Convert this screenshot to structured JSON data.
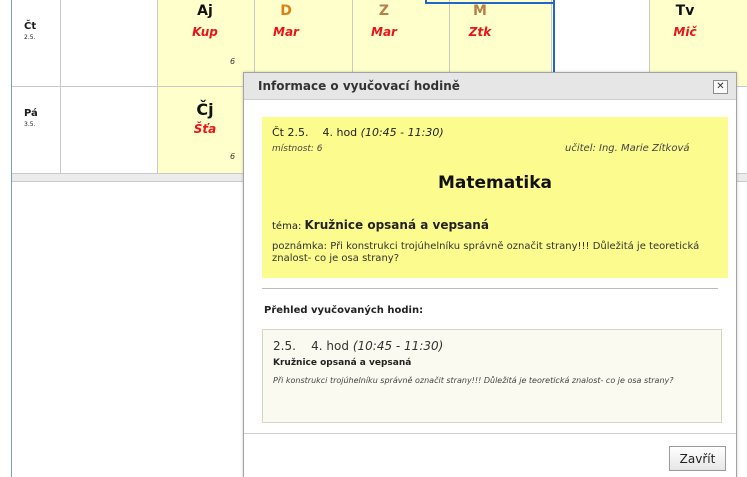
{
  "timetable": {
    "days": [
      {
        "label": "Čt",
        "date": "2.5."
      },
      {
        "label": "Pá",
        "date": "3.5."
      }
    ],
    "thursday": {
      "aj": {
        "subject": "Aj",
        "teacher": "Kup",
        "room": "6"
      },
      "d": {
        "subject": "D",
        "teacher": "Mar"
      },
      "z": {
        "subject": "Z",
        "teacher": "Mar"
      },
      "m": {
        "subject": "M",
        "teacher": "Ztk"
      },
      "tv": {
        "subject": "Tv",
        "teacher": "Mič"
      }
    },
    "friday": {
      "cj": {
        "subject": "Čj",
        "teacher": "Šťa",
        "room": "6"
      }
    }
  },
  "dialog": {
    "title": "Informace o vyučovací hodině",
    "close_glyph": "✕",
    "lesson": {
      "date": "Čt 2.5.",
      "hour": "4. hod",
      "time": "(10:45 - 11:30)",
      "room": "místnost: 6",
      "teacher": "učitel: Ing. Marie Zítková",
      "subject": "Matematika",
      "topic_label": "téma:",
      "topic": "Kružnice opsaná a vepsaná",
      "note": "poznámka: Při konstrukci trojúhelníku správně označit strany!!! Důležitá je teoretická znalost- co je osa strany?"
    },
    "overview_title": "Přehled vyučovaných hodin:",
    "overview": {
      "date": "2.5.",
      "hour": "4. hod",
      "time": "(10:45 - 11:30)",
      "topic": "Kružnice opsaná a vepsaná",
      "note": "Při konstrukci trojúhelníku správně označit strany!!! Důležitá je teoretická znalost- co je osa strany?"
    },
    "close_button": "Zavřít"
  },
  "colors": {
    "accent_red": "#e8141c",
    "highlight_yellow": "#fbfb8e",
    "arrow_blue": "#1f66c8"
  }
}
